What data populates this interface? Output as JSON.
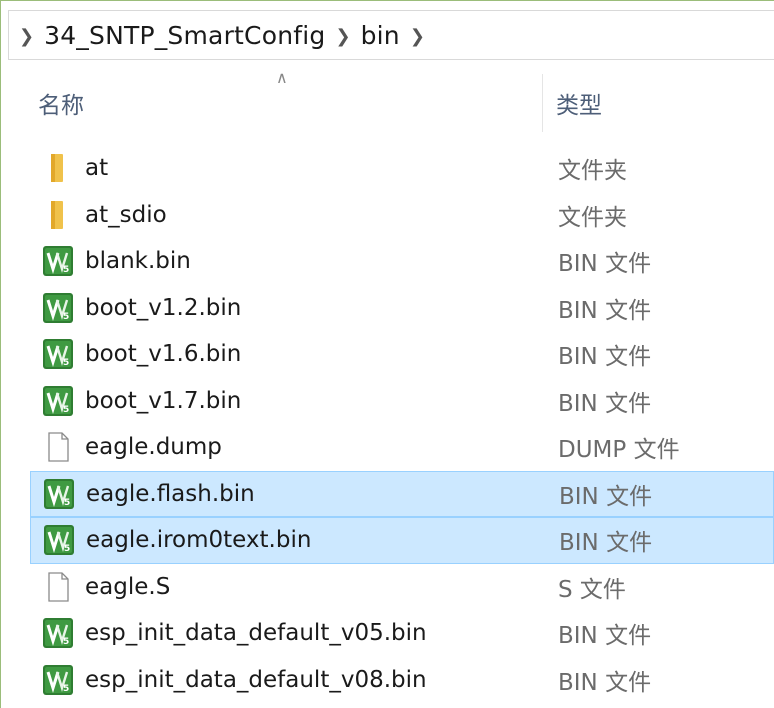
{
  "breadcrumb": {
    "items": [
      "34_SNTP_SmartConfig",
      "bin"
    ]
  },
  "columns": {
    "name": "名称",
    "type": "类型"
  },
  "files": [
    {
      "name": "at",
      "type": "文件夹",
      "icon": "folder-icon",
      "selected": false
    },
    {
      "name": "at_sdio",
      "type": "文件夹",
      "icon": "folder-icon",
      "selected": false
    },
    {
      "name": "blank.bin",
      "type": "BIN 文件",
      "icon": "bin-file-icon",
      "selected": false
    },
    {
      "name": "boot_v1.2.bin",
      "type": "BIN 文件",
      "icon": "bin-file-icon",
      "selected": false
    },
    {
      "name": "boot_v1.6.bin",
      "type": "BIN 文件",
      "icon": "bin-file-icon",
      "selected": false
    },
    {
      "name": "boot_v1.7.bin",
      "type": "BIN 文件",
      "icon": "bin-file-icon",
      "selected": false
    },
    {
      "name": "eagle.dump",
      "type": "DUMP 文件",
      "icon": "document-icon",
      "selected": false
    },
    {
      "name": "eagle.flash.bin",
      "type": "BIN 文件",
      "icon": "bin-file-icon",
      "selected": true
    },
    {
      "name": "eagle.irom0text.bin",
      "type": "BIN 文件",
      "icon": "bin-file-icon",
      "selected": true
    },
    {
      "name": "eagle.S",
      "type": "S 文件",
      "icon": "document-icon",
      "selected": false
    },
    {
      "name": "esp_init_data_default_v05.bin",
      "type": "BIN 文件",
      "icon": "bin-file-icon",
      "selected": false
    },
    {
      "name": "esp_init_data_default_v08.bin",
      "type": "BIN 文件",
      "icon": "bin-file-icon",
      "selected": false
    }
  ],
  "colors": {
    "selection_bg": "#cce8ff",
    "selection_border": "#99d1ff",
    "bin_icon_green": "#3a8f3a",
    "folder_yellow": "#f0c24b"
  }
}
